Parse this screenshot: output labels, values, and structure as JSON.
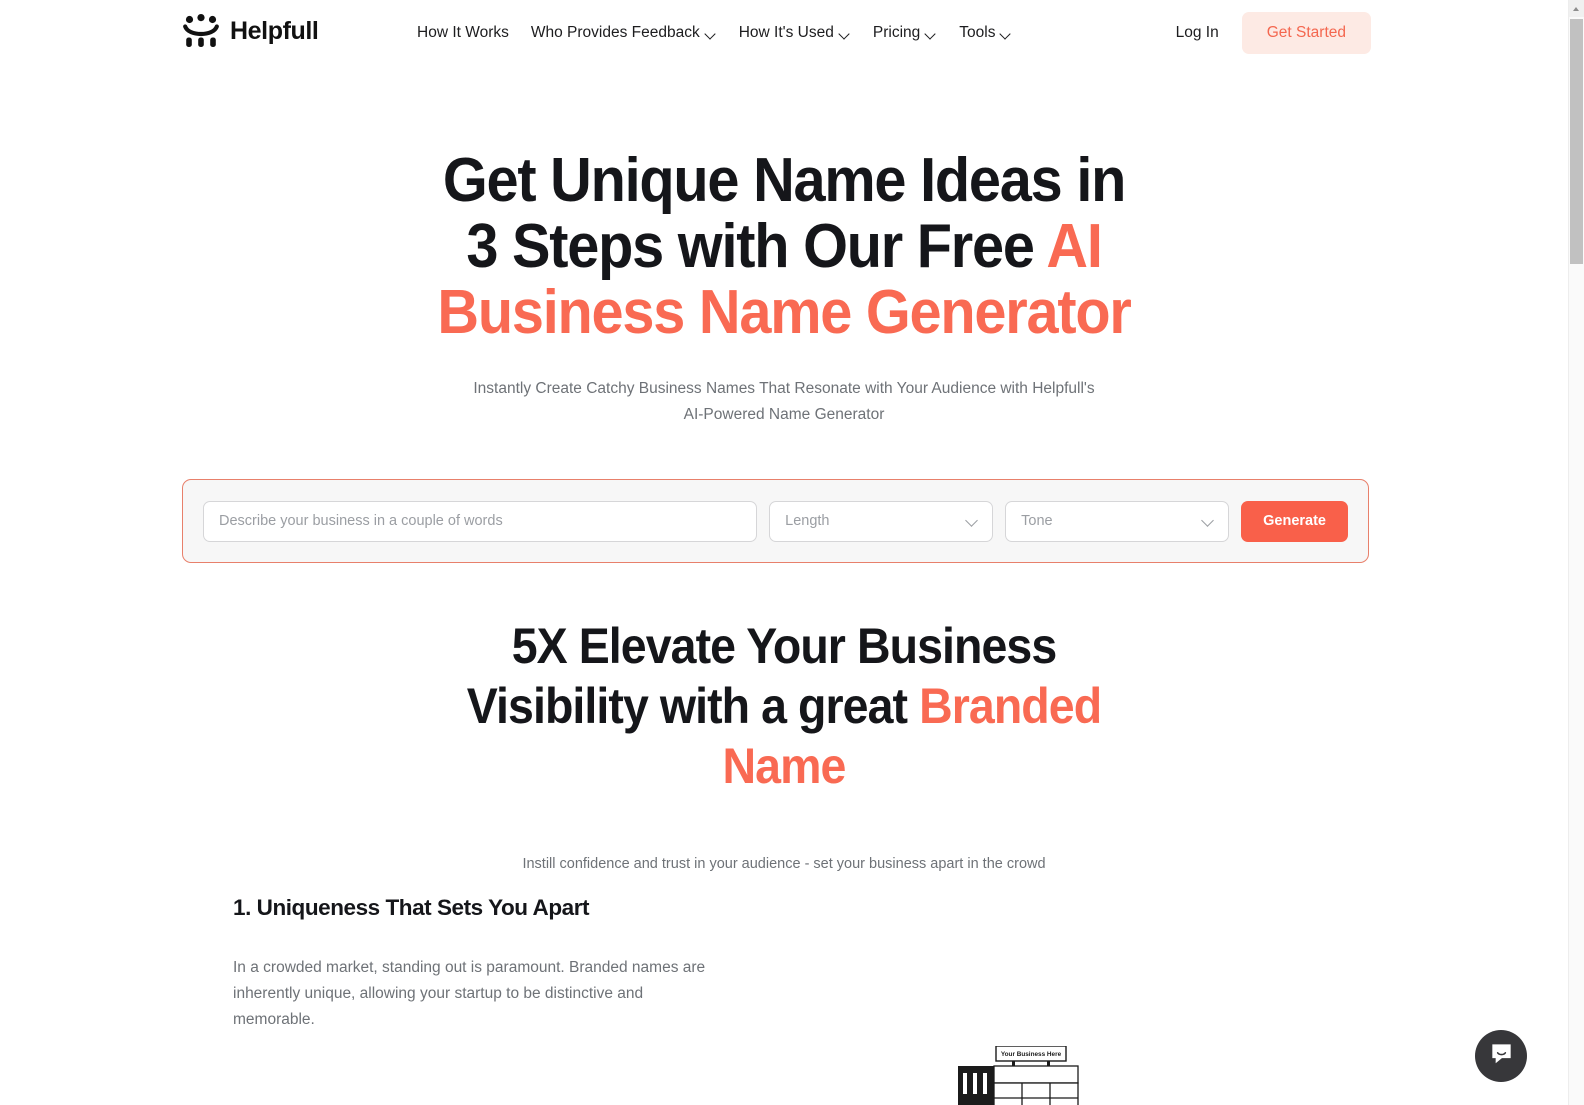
{
  "header": {
    "brand_name": "Helpfull",
    "logo_icon": "three-people-smile-icon",
    "nav": [
      {
        "label": "How It Works",
        "has_caret": false
      },
      {
        "label": "Who Provides Feedback",
        "has_caret": true
      },
      {
        "label": "How It's Used",
        "has_caret": true
      },
      {
        "label": "Pricing",
        "has_caret": true
      },
      {
        "label": "Tools",
        "has_caret": true
      }
    ],
    "login_label": "Log In",
    "cta_label": "Get Started"
  },
  "hero": {
    "title_part1": "Get Unique Name Ideas in 3 Steps with Our Free ",
    "title_accent": "AI Business Name Generator",
    "subtitle": "Instantly Create Catchy Business Names That Resonate with Your Audience with Helpfull's AI-Powered Name Generator"
  },
  "generator": {
    "description_placeholder": "Describe your business in a couple of words",
    "description_value": "",
    "length_label": "Length",
    "tone_label": "Tone",
    "generate_label": "Generate",
    "border_color": "#e8806b",
    "button_color": "#f9604a"
  },
  "section2": {
    "title_part1": "5X Elevate Your Business Visibility with a great ",
    "title_accent": "Branded Name",
    "subtitle": "Instill confidence and trust in your audience - set your business apart in the crowd"
  },
  "feature": {
    "title": "1. Uniqueness That Sets You Apart",
    "body": "In a crowded market, standing out is paramount. Branded names are inherently unique, allowing your startup to be distinctive and memorable."
  },
  "illustration": {
    "sign_text": "Your Business Here",
    "name": "storefront-illustration"
  },
  "chat": {
    "icon": "chat-bubble-smile-icon"
  },
  "theme": {
    "accent": "#f96a53",
    "accent_soft": "#fdeae4",
    "text": "#15161a",
    "muted": "#6e7277"
  }
}
